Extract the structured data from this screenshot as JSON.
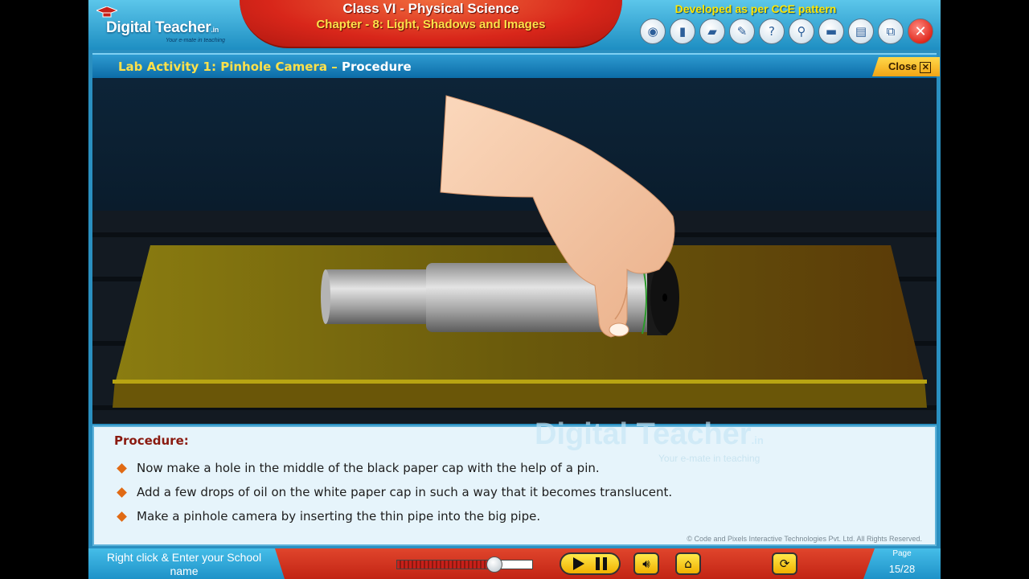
{
  "header": {
    "logo_text_1": "Digital",
    "logo_text_2": "Teacher",
    "logo_suffix": ".in",
    "logo_tagline": "Your e-mate in teaching",
    "class_title": "Class VI - Physical Science",
    "chapter_title": "Chapter - 8: Light, Shadows and Images",
    "cce_text": "Developed as per CCE pattern",
    "toolbar_icons": [
      "camera-icon",
      "ebook-icon",
      "notebook-icon",
      "notepad-icon",
      "help-icon",
      "search-icon",
      "book-icon",
      "dictionary-icon",
      "window-resize-icon",
      "close-icon"
    ]
  },
  "activity": {
    "title": "Lab Activity 1: Pinhole Camera",
    "separator": " – ",
    "subtitle": "Procedure",
    "close_label": "Close"
  },
  "procedure": {
    "heading": "Procedure:",
    "items": [
      "Now make a hole in the middle of the black paper cap with the help of a pin.",
      "Add a few drops of oil on the white paper cap in such a way that it becomes translucent.",
      "Make a pinhole camera by inserting the thin pipe into the big pipe."
    ],
    "watermark": "Digital Teacher",
    "watermark_suffix": ".in",
    "watermark_tagline": "Your e-mate in teaching",
    "copyright": "© Code and Pixels Interactive Technologies  Pvt. Ltd. All Rights Reserved."
  },
  "footer": {
    "school_prompt": "Right click & Enter your School name",
    "progress": 0.72,
    "page_label": "Page",
    "page_number": "15/28"
  },
  "colors": {
    "accent_red": "#d8261a",
    "title_yellow": "#ffe14a",
    "header_blue": "#1e8ec2"
  }
}
